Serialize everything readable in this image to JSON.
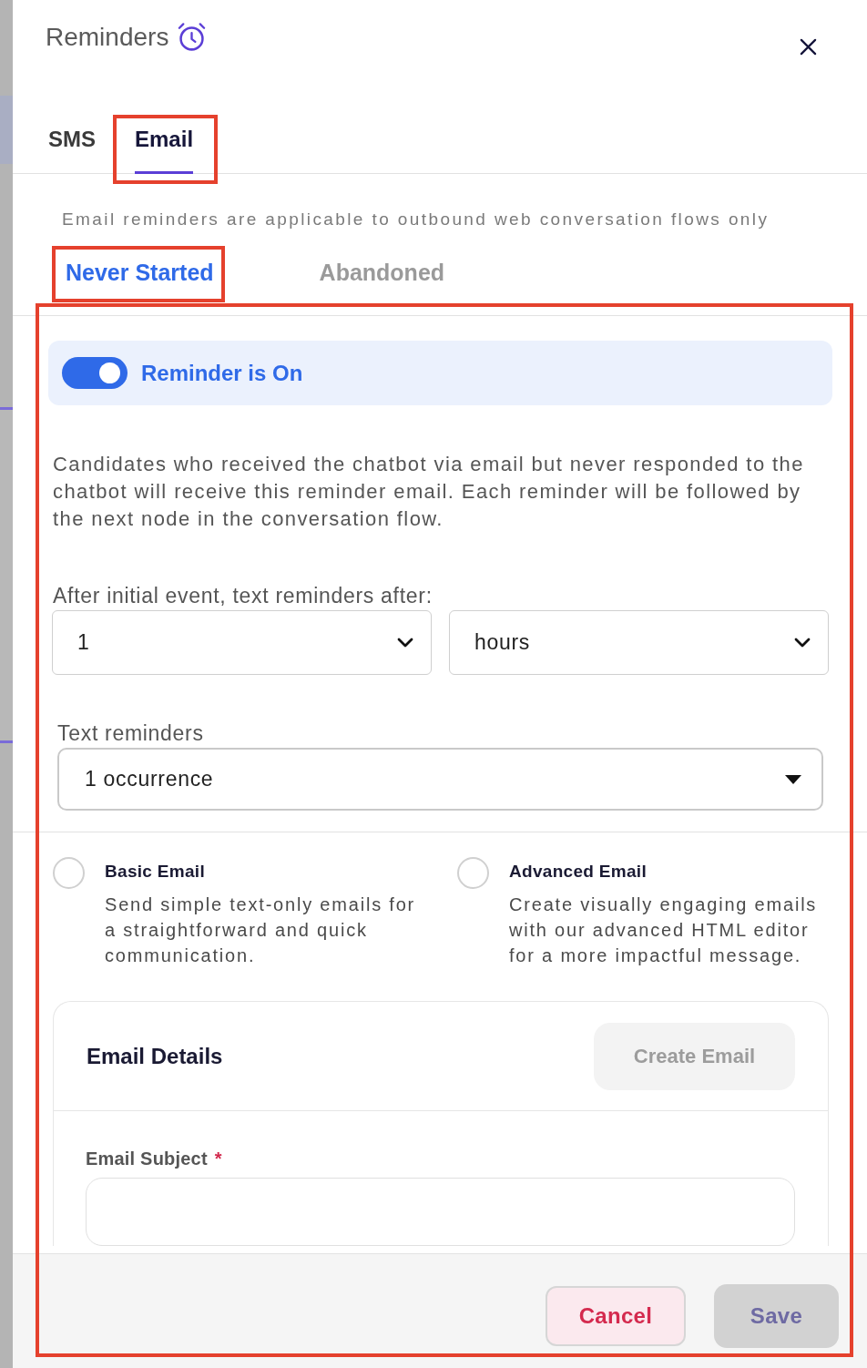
{
  "dialog": {
    "title": "Reminders"
  },
  "channel_tabs": [
    {
      "label": "SMS",
      "selected": false,
      "highlighted": false
    },
    {
      "label": "Email",
      "selected": true,
      "highlighted": true
    }
  ],
  "note": "Email reminders are applicable to outbound web conversation flows only",
  "trigger_tabs": [
    {
      "label": "Never Started",
      "selected": true,
      "highlighted": true
    },
    {
      "label": "Abandoned",
      "selected": false,
      "highlighted": false
    }
  ],
  "panel": {
    "highlighted": true,
    "reminder_toggle": {
      "label": "Reminder is On",
      "on": true
    },
    "description": "Candidates who received the chatbot via email but never responded to the chatbot will receive this reminder email. Each reminder will be followed by the next node in the conversation flow.",
    "delay": {
      "label": "After initial event, text reminders after:",
      "amount": "1",
      "unit": "hours"
    },
    "occurrences": {
      "label": "Text reminders",
      "value": "1 occurrence"
    },
    "email_types": [
      {
        "title": "Basic Email",
        "description": "Send simple text-only emails for a straightforward and quick communication.",
        "selected": false
      },
      {
        "title": "Advanced Email",
        "description": "Create visually engaging emails with our advanced HTML editor for a more impactful message.",
        "selected": false
      }
    ],
    "email_details": {
      "title": "Email Details",
      "create_button": {
        "label": "Create Email",
        "disabled": true
      },
      "subject": {
        "label": "Email Subject",
        "required_mark": "*"
      }
    }
  },
  "footer": {
    "buttons": [
      {
        "label": "Cancel",
        "kind": "cancel",
        "disabled": false
      },
      {
        "label": "Save",
        "kind": "save",
        "disabled": true
      }
    ]
  }
}
